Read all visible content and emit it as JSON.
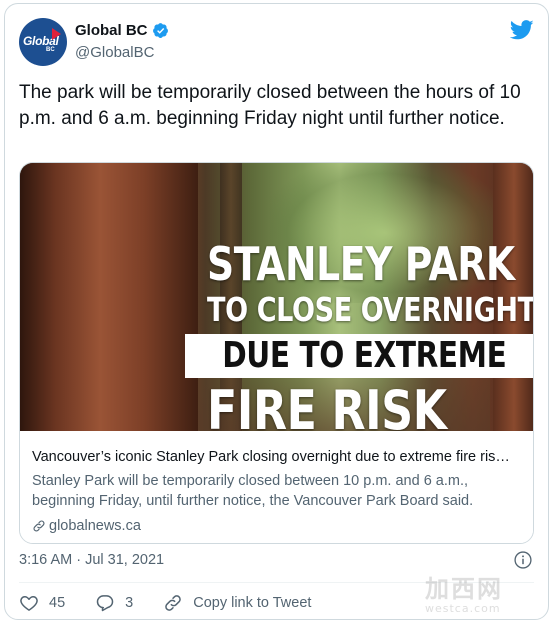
{
  "author": {
    "name": "Global BC",
    "handle": "@GlobalBC",
    "avatar_text": "Global",
    "avatar_sub": "BC",
    "verified": true
  },
  "tweet": {
    "text": "The park will be temporarily closed between the hours of 10 p.m. and 6 a.m. beginning Friday night until further notice.",
    "timestamp": "3:16 AM · Jul 31, 2021"
  },
  "card": {
    "image_headline": [
      "STANLEY PARK",
      "TO CLOSE OVERNIGHT",
      "DUE TO EXTREME",
      "FIRE RISK"
    ],
    "title": "Vancouver’s iconic Stanley Park closing overnight due to extreme fire ris…",
    "description": "Stanley Park will be temporarily closed between 10 p.m. and 6 a.m., beginning Friday, until further notice, the Vancouver Park Board said.",
    "domain": "globalnews.ca"
  },
  "actions": {
    "likes": "45",
    "replies": "3",
    "copy_link_label": "Copy link to Tweet"
  },
  "watermark": {
    "cn": "加西网",
    "en": "westca.com"
  },
  "colors": {
    "twitter_blue": "#1d9bf0",
    "text_primary": "#0f1419",
    "text_secondary": "#536471",
    "border": "#cfd9de"
  },
  "icons": [
    "verified-badge-icon",
    "twitter-bird-icon",
    "link-icon",
    "info-icon",
    "heart-icon",
    "reply-icon",
    "copy-link-icon"
  ]
}
